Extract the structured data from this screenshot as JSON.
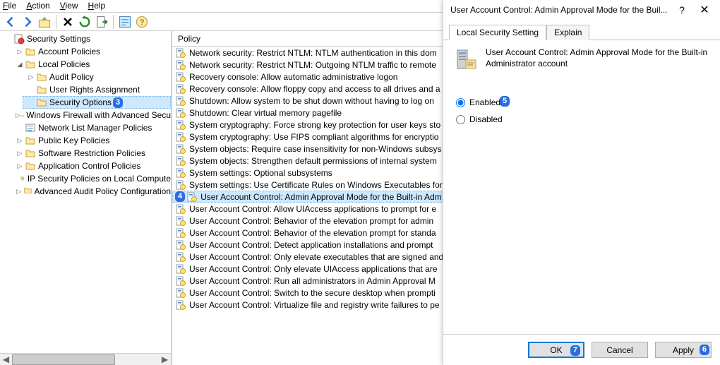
{
  "menu": {
    "file": "File",
    "action": "Action",
    "view": "View",
    "help": "Help"
  },
  "tree": {
    "root": "Security Settings",
    "nodes": [
      {
        "label": "Account Policies",
        "indent": 2,
        "exp": "▷",
        "icon": "folder"
      },
      {
        "label": "Local Policies",
        "indent": 2,
        "exp": "◢",
        "icon": "folder"
      },
      {
        "label": "Audit Policy",
        "indent": 3,
        "exp": "▷",
        "icon": "folder"
      },
      {
        "label": "User Rights Assignment",
        "indent": 3,
        "exp": "",
        "icon": "folder"
      },
      {
        "label": "Security Options",
        "indent": 3,
        "exp": "",
        "icon": "folder",
        "selected": true,
        "badge": "3"
      },
      {
        "label": "Windows Firewall with Advanced Secu",
        "indent": 2,
        "exp": "▷",
        "icon": "folder"
      },
      {
        "label": "Network List Manager Policies",
        "indent": 2,
        "exp": "",
        "icon": "list"
      },
      {
        "label": "Public Key Policies",
        "indent": 2,
        "exp": "▷",
        "icon": "folder"
      },
      {
        "label": "Software Restriction Policies",
        "indent": 2,
        "exp": "▷",
        "icon": "folder"
      },
      {
        "label": "Application Control Policies",
        "indent": 2,
        "exp": "▷",
        "icon": "folder"
      },
      {
        "label": "IP Security Policies on Local Compute",
        "indent": 2,
        "exp": "",
        "icon": "shield"
      },
      {
        "label": "Advanced Audit Policy Configuration",
        "indent": 2,
        "exp": "▷",
        "icon": "folder"
      }
    ]
  },
  "list": {
    "header": "Policy",
    "rows": [
      "Network security: Restrict NTLM: NTLM authentication in this dom",
      "Network security: Restrict NTLM: Outgoing NTLM traffic to remote",
      "Recovery console: Allow automatic administrative logon",
      "Recovery console: Allow floppy copy and access to all drives and a",
      "Shutdown: Allow system to be shut down without having to log on",
      "Shutdown: Clear virtual memory pagefile",
      "System cryptography: Force strong key protection for user keys sto",
      "System cryptography: Use FIPS compliant algorithms for encryptio",
      "System objects: Require case insensitivity for non-Windows subsys",
      "System objects: Strengthen default permissions of internal system",
      "System settings: Optional subsystems",
      "System settings: Use Certificate Rules on Windows Executables for",
      "User Account Control: Admin Approval Mode for the Built-in Adm",
      "User Account Control: Allow UIAccess applications to prompt for e",
      "User Account Control: Behavior of the elevation prompt for admin",
      "User Account Control: Behavior of the elevation prompt for standa",
      "User Account Control: Detect application installations and prompt",
      "User Account Control: Only elevate executables that are signed and",
      "User Account Control: Only elevate UIAccess applications that are",
      "User Account Control: Run all administrators in Admin Approval M",
      "User Account Control: Switch to the secure desktop when prompti",
      "User Account Control: Virtualize file and registry write failures to pe"
    ],
    "selected_index": 12,
    "selected_badge": "4"
  },
  "dialog": {
    "title": "User Account Control: Admin Approval Mode for the Buil...",
    "tab_setting": "Local Security Setting",
    "tab_explain": "Explain",
    "desc": "User Account Control: Admin Approval Mode for the Built-in Administrator account",
    "opt_enabled": "Enabled",
    "opt_disabled": "Disabled",
    "enabled_badge": "5",
    "btn_ok": "OK",
    "btn_cancel": "Cancel",
    "btn_apply": "Apply",
    "ok_badge": "7",
    "apply_badge": "6"
  }
}
